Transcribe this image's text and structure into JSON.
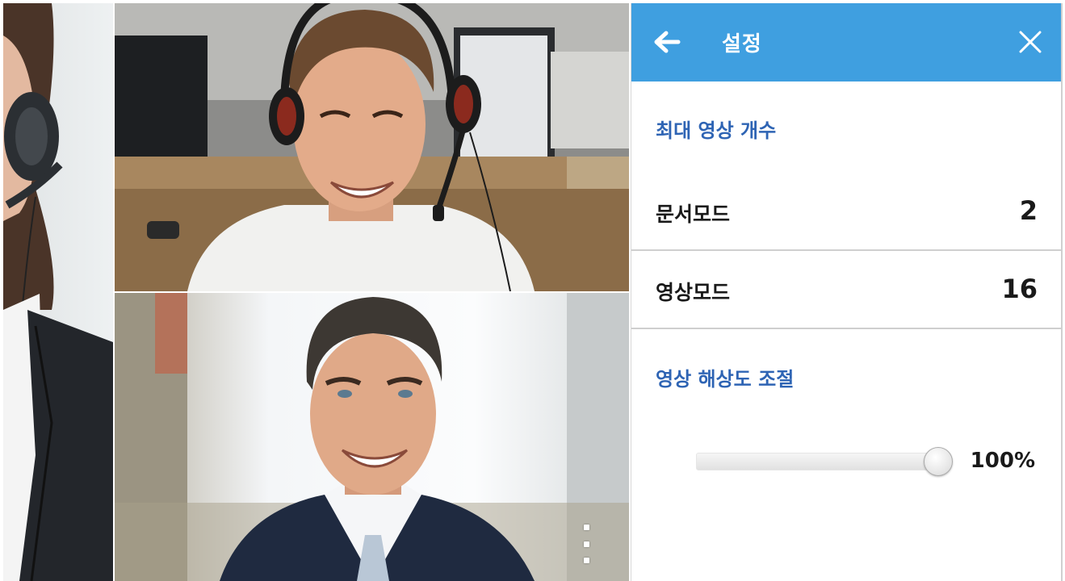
{
  "settings": {
    "title": "설정",
    "max_video_section": "최대 영상 개수",
    "document_mode": {
      "label": "문서모드",
      "value": "2"
    },
    "video_mode": {
      "label": "영상모드",
      "value": "16"
    },
    "resolution_section": "영상 해상도 조절",
    "resolution": {
      "percent_label": "100%",
      "value": 100
    }
  },
  "colors": {
    "header_bg": "#3f9fe0",
    "section_title": "#2e64b4"
  },
  "icons": {
    "back": "arrow-left-icon",
    "close": "close-icon",
    "more": "more-vertical-icon"
  }
}
